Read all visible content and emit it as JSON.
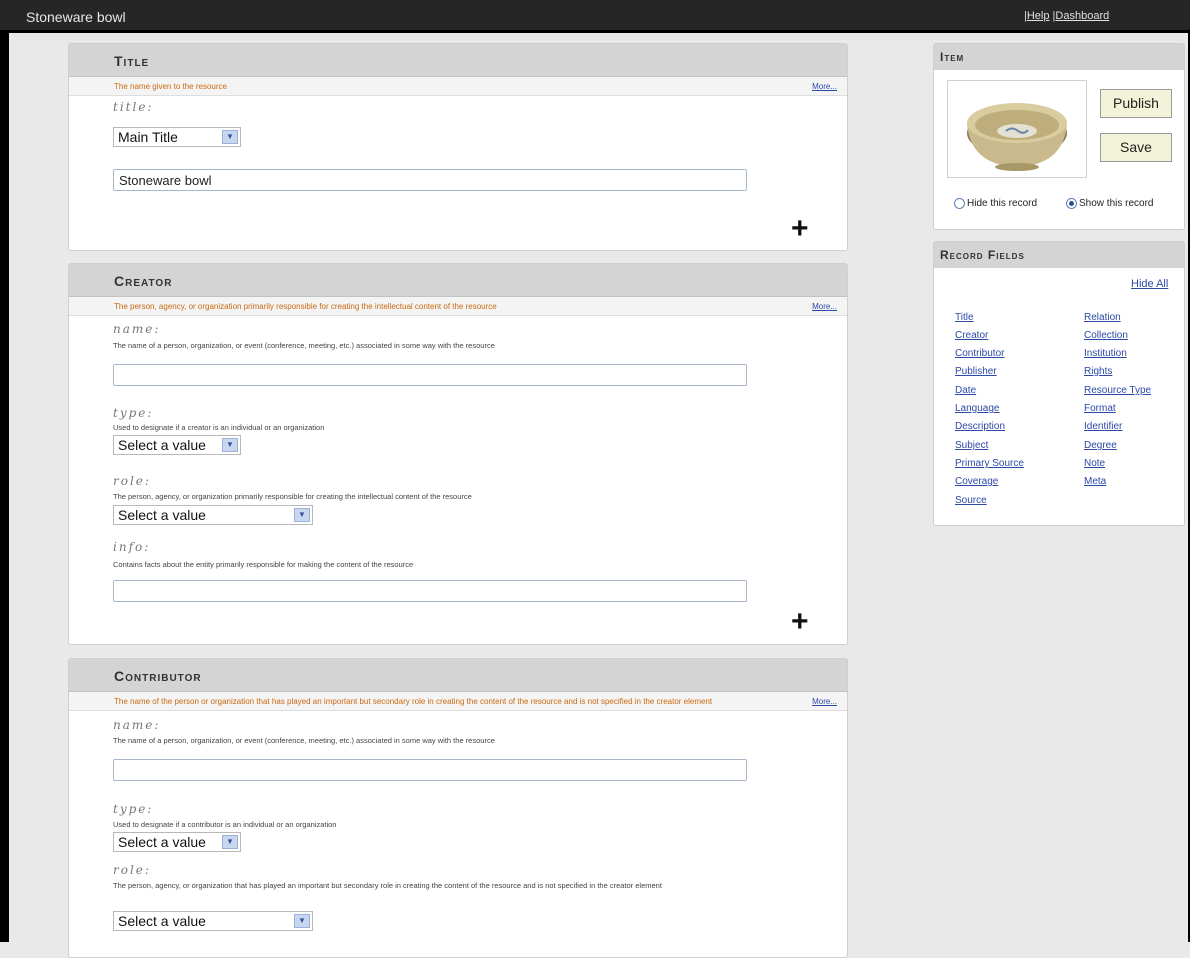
{
  "topbar": {
    "title": "Stoneware bowl",
    "sep1": "|",
    "help": "Help",
    "sep2": "|",
    "dashboard": "Dashboard"
  },
  "more_label": "More...",
  "select_arrow": "▼",
  "plus_symbol": "+",
  "sections": {
    "title": {
      "heading": "Title",
      "description": "The name given to the resource",
      "field_label": "title:",
      "title_type": "Main Title",
      "title_value": "Stoneware bowl"
    },
    "creator": {
      "heading": "Creator",
      "description": "The person, agency, or organization primarily responsible for creating the intellectual content of the resource",
      "name_label": "name:",
      "name_desc": "The name of a person, organization, or event (conference, meeting, etc.) associated in some way with the resource",
      "name_value": "",
      "type_label": "type:",
      "type_desc": "Used to designate if a creator is an individual or an organization",
      "type_value": "Select a value",
      "role_label": "role:",
      "role_desc": "The person, agency, or organization primarily responsible for creating the intellectual content of the resource",
      "role_value": "Select a value",
      "info_label": "info:",
      "info_desc": "Contains facts about the entity primarily responsible for making the content of the resource",
      "info_value": ""
    },
    "contributor": {
      "heading": "Contributor",
      "description": "The name of the person or organization that has played an important but secondary role in creating the content of the resource and is not specified in the creator element",
      "name_label": "name:",
      "name_desc": "The name of a person, organization, or event (conference, meeting, etc.) associated in some way with the resource",
      "name_value": "",
      "type_label": "type:",
      "type_desc": "Used to designate if a contributor is an individual or an organization",
      "type_value": "Select a value",
      "role_label": "role:",
      "role_desc": "The person, agency, or organization that has played an important but secondary role in creating the content of the resource and is not specified in the creator element",
      "role_value": "Select a value"
    }
  },
  "item": {
    "heading": "Item",
    "publish": "Publish",
    "save": "Save",
    "hide_record": "Hide this record",
    "show_record": "Show this record",
    "selected_visibility": "show"
  },
  "record_fields": {
    "heading": "Record Fields",
    "hide_all": "Hide All",
    "col1": [
      "Title",
      "Creator",
      "Contributor",
      "Publisher",
      "Date",
      "Language",
      "Description",
      "Subject",
      "Primary Source",
      "Coverage",
      "Source"
    ],
    "col2": [
      "Relation",
      "Collection",
      "Institution",
      "Rights",
      "Resource Type",
      "Format",
      "Identifier",
      "Degree",
      "Note",
      "Meta"
    ]
  }
}
